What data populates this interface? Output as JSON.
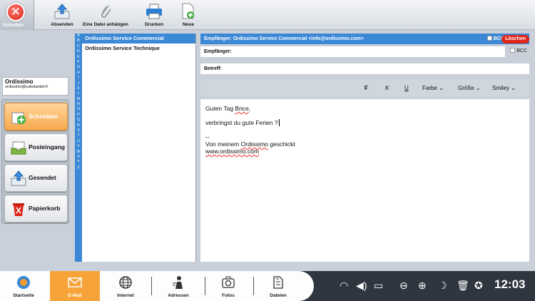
{
  "toolbar": {
    "close_tab_label": "Schreiben",
    "buttons": [
      {
        "label": "Absenden",
        "icon": "send-icon"
      },
      {
        "label": "Eine Datei anhängen",
        "icon": "paperclip-icon"
      },
      {
        "label": "Drucken",
        "icon": "printer-icon"
      },
      {
        "label": "Neue",
        "icon": "new-document-icon"
      }
    ]
  },
  "account": {
    "name": "Ordissimo",
    "email": "ordissimo@substantiel.fr"
  },
  "folders": [
    {
      "label": "Schreiben",
      "icon": "compose-icon",
      "active": true
    },
    {
      "label": "Posteingang",
      "icon": "inbox-icon"
    },
    {
      "label": "Gesendet",
      "icon": "sent-icon"
    },
    {
      "label": "Papierkorb",
      "icon": "trash-icon"
    }
  ],
  "alphabet": [
    "A",
    "B",
    "C",
    "D",
    "E",
    "F",
    "G",
    "H",
    "I",
    "J",
    "K",
    "L",
    "M",
    "N",
    "O",
    "P",
    "Q",
    "R",
    "S",
    "T",
    "U",
    "V",
    "W",
    "X",
    "Y",
    "Z"
  ],
  "contacts": [
    {
      "name": "Ordissimo Service Commercial",
      "selected": true
    },
    {
      "name": "Ordissimo Service Technique"
    }
  ],
  "compose": {
    "to_label": "Empfänger:",
    "to_value": "Ordissimo Service Commercial <info@ordissimo.com>",
    "bcc_label": "BCC",
    "delete_label": "Löschen",
    "cc_label": "Empfänger:",
    "subject_label": "Betreff:",
    "format": {
      "bold": "F",
      "italic": "K",
      "underline": "U",
      "color": "Farbe",
      "size": "Größe",
      "smiley": "Smiley"
    },
    "body": {
      "greeting_prefix": "Guten Tag ",
      "greeting_name": "Brice",
      "greeting_suffix": ",",
      "line2": "verbringst du gute Ferien ?",
      "sig_dash": "--",
      "sig_prefix": "Von meinem ",
      "sig_brand": "Ordissimo",
      "sig_suffix": " geschickt",
      "sig_url": "www.ordissimo.com"
    }
  },
  "taskbar": {
    "items": [
      {
        "label": "Startseite",
        "icon": "home-icon"
      },
      {
        "label": "E-Mail",
        "icon": "mail-icon",
        "active": true
      },
      {
        "label": "Internet",
        "icon": "globe-icon"
      },
      {
        "label": "Adressen",
        "icon": "contacts-icon"
      },
      {
        "label": "Fotos",
        "icon": "camera-icon"
      },
      {
        "label": "Dateien",
        "icon": "files-icon"
      }
    ],
    "clock": "12:03"
  }
}
